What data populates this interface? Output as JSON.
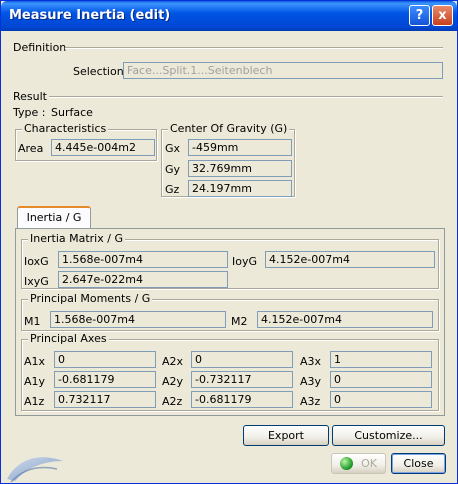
{
  "window": {
    "title": "Measure Inertia (edit)",
    "help_icon": "?",
    "close_icon": "x"
  },
  "definition": {
    "header": "Definition",
    "selection_label": "Selection :",
    "selection_value": "Face...Split.1...Seitenblech"
  },
  "result": {
    "header": "Result",
    "type_label": "Type :",
    "type_value": "Surface",
    "characteristics": {
      "legend": "Characteristics",
      "area_label": "Area",
      "area_value": "4.445e-004m2"
    },
    "center_of_gravity": {
      "legend": "Center Of Gravity (G)",
      "gx_label": "Gx",
      "gx_value": "-459mm",
      "gy_label": "Gy",
      "gy_value": "32.769mm",
      "gz_label": "Gz",
      "gz_value": "24.197mm"
    }
  },
  "tabs": [
    {
      "label": "Inertia / G",
      "active": true
    }
  ],
  "inertia_matrix": {
    "legend": "Inertia Matrix / G",
    "ioxg_label": "IoxG",
    "ioxg_value": "1.568e-007m4",
    "ioyg_label": "IoyG",
    "ioyg_value": "4.152e-007m4",
    "ixyg_label": "IxyG",
    "ixyg_value": "2.647e-022m4"
  },
  "principal_moments": {
    "legend": "Principal Moments / G",
    "m1_label": "M1",
    "m1_value": "1.568e-007m4",
    "m2_label": "M2",
    "m2_value": "4.152e-007m4"
  },
  "principal_axes": {
    "legend": "Principal Axes",
    "a1x_label": "A1x",
    "a1x_value": "0",
    "a2x_label": "A2x",
    "a2x_value": "0",
    "a3x_label": "A3x",
    "a3x_value": "1",
    "a1y_label": "A1y",
    "a1y_value": "-0.681179",
    "a2y_label": "A2y",
    "a2y_value": "-0.732117",
    "a3y_label": "A3y",
    "a3y_value": "0",
    "a1z_label": "A1z",
    "a1z_value": "0.732117",
    "a2z_label": "A2z",
    "a2z_value": "-0.681179",
    "a3z_label": "A3z",
    "a3z_value": "0"
  },
  "buttons": {
    "export": "Export",
    "customize": "Customize...",
    "ok": "OK",
    "close": "Close"
  },
  "icons": {
    "ok_icon": "green-ball-icon",
    "logo": "catia-logo-icon"
  },
  "colors": {
    "titlebar": "#0055e5",
    "dialog_bg": "#ece9d8",
    "tab_accent": "#e68b2c"
  }
}
